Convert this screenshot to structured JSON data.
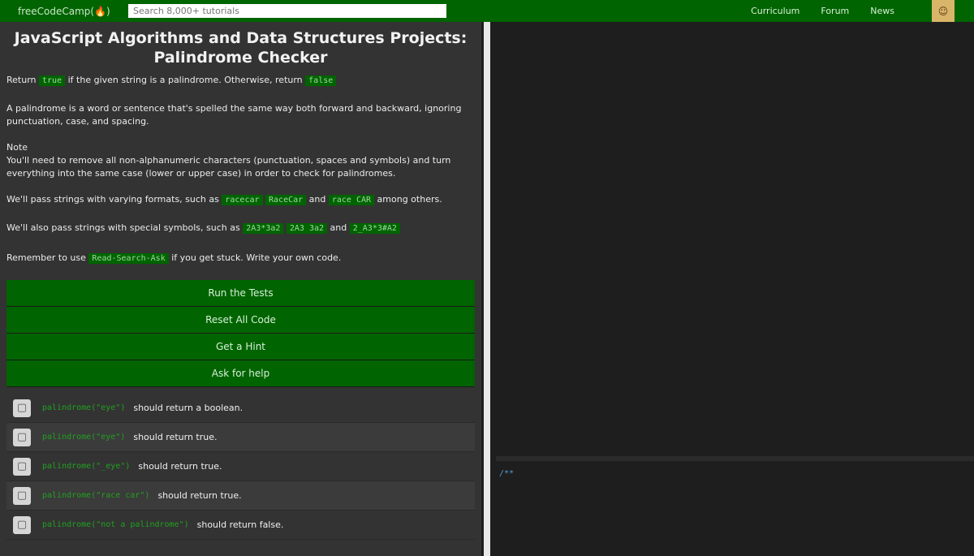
{
  "topbar": {
    "logo": "freeCodeCamp(🔥)",
    "search_placeholder": "Search 8,000+ tutorials",
    "links": [
      "Curriculum",
      "Forum",
      "News"
    ],
    "avatar": "☺"
  },
  "challenge": {
    "title": "JavaScript Algorithms and Data Structures Projects: Palindrome Checker",
    "p1": {
      "before": "Return",
      "code1": "true",
      "middle": "if the given string is a palindrome. Otherwise, return",
      "code2": "false"
    },
    "p2": "A palindrome is a word or sentence that's spelled the same way both forward and backward, ignoring punctuation, case, and spacing.",
    "p3_note": "Note",
    "p3": "You'll need to remove all non-alphanumeric characters (punctuation, spaces and symbols) and turn everything into the same case (lower or upper case) in order to check for palindromes.",
    "p4": {
      "before": "We'll pass strings with varying formats, such as",
      "code1": "racecar",
      "code2": "RaceCar",
      "and": "and",
      "code3": "race CAR",
      "after": "among others."
    },
    "p5": {
      "before": "We'll also pass strings with special symbols, such as",
      "code1": "2A3*3a2",
      "code2": "2A3 3a2",
      "and": "and",
      "code3": "2_A3*3#A2"
    },
    "p6": {
      "before": "Remember to use",
      "code1": "Read-Search-Ask",
      "after": "if you get stuck. Write your own code."
    }
  },
  "buttons": [
    "Run the Tests",
    "Reset All Code",
    "Get a Hint",
    "Ask for help"
  ],
  "tests": [
    {
      "code": "palindrome(\"eye\")",
      "label": "should return a boolean."
    },
    {
      "code": "palindrome(\"eye\")",
      "label": "should return true."
    },
    {
      "code": "palindrome(\"_eye\")",
      "label": "should return true."
    },
    {
      "code": "palindrome(\"race car\")",
      "label": "should return true."
    },
    {
      "code": "palindrome(\"not a palindrome\")",
      "label": "should return false."
    }
  ],
  "editor": {
    "console_text": "/**"
  }
}
